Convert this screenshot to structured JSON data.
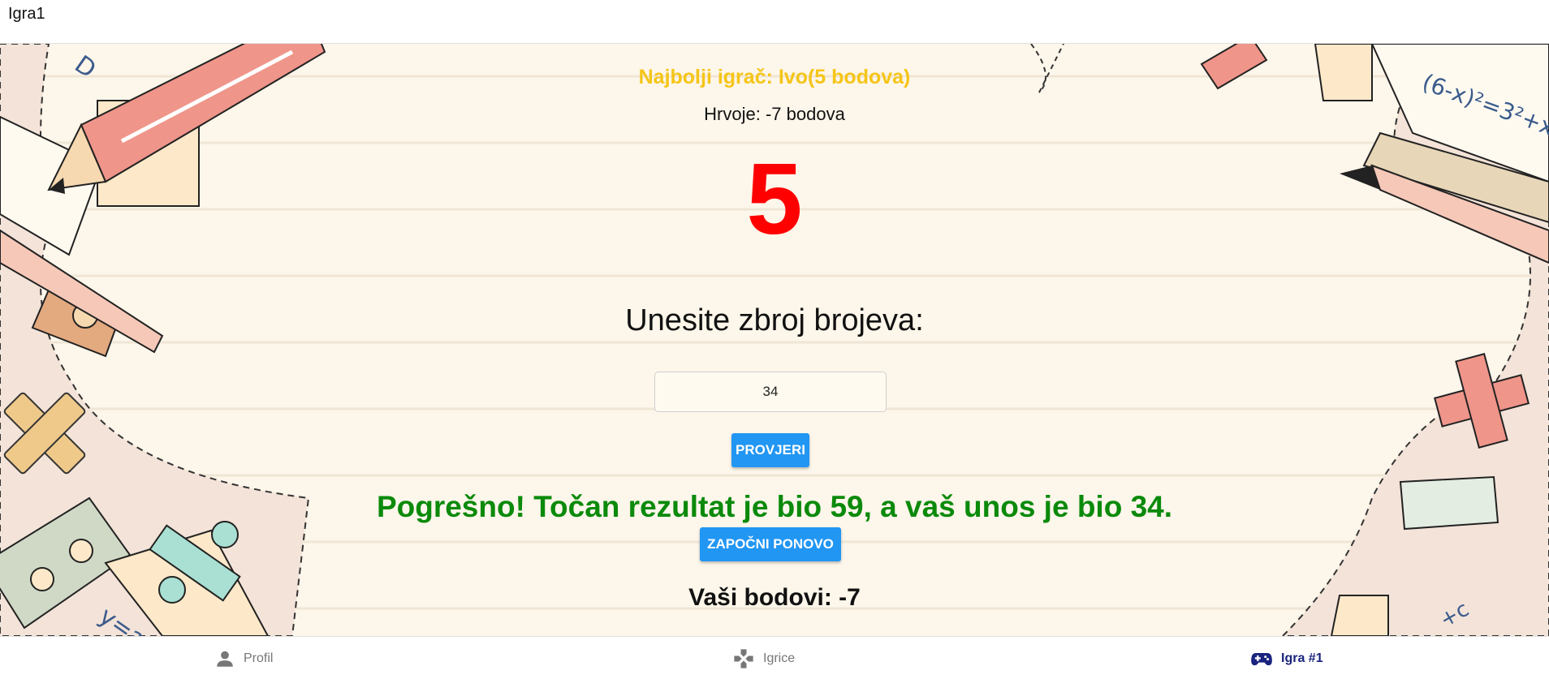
{
  "app": {
    "title": "Igra1"
  },
  "game": {
    "best_player": "Najbolji igrač: Ivo(5 bodova)",
    "current_player": "Hrvoje: -7 bodova",
    "displayed_number": "5",
    "prompt": "Unesite zbroj brojeva:",
    "answer_value": "34",
    "check_label": "PROVJERI",
    "result_message": "Pogrešno! Točan rezultat je bio 59, a vaš unos je bio 34.",
    "restart_label": "ZAPOČNI PONOVO",
    "score_label": "Vaši bodovi: -7"
  },
  "colors": {
    "best_player": "#f5c518",
    "number": "#ff0000",
    "result": "#0b8a0b",
    "button": "#2196f3",
    "active_nav": "#1a237e"
  },
  "bottom_nav": {
    "items": [
      {
        "label": "Profil",
        "icon": "person-icon",
        "active": false
      },
      {
        "label": "Igrice",
        "icon": "gamepad-cross-icon",
        "active": false
      },
      {
        "label": "Igra #1",
        "icon": "game-controller-icon",
        "active": true
      }
    ]
  }
}
